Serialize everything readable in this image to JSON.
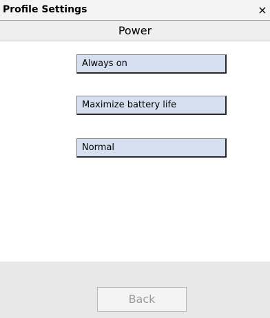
{
  "window": {
    "title": "Profile Settings",
    "close_glyph": "×"
  },
  "header": {
    "title": "Power"
  },
  "options": [
    {
      "label": "Always on"
    },
    {
      "label": "Maximize battery life"
    },
    {
      "label": "Normal"
    }
  ],
  "footer": {
    "back_label": "Back",
    "back_enabled": false
  },
  "colors": {
    "button_fill": "#d6dff0",
    "disabled_text": "#9a9a9a",
    "footer_bg": "#e8e8e8"
  }
}
